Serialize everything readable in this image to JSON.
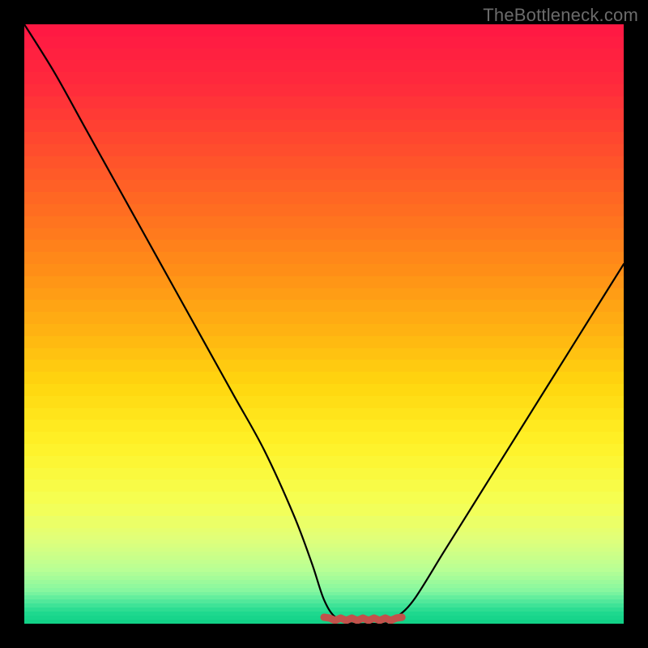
{
  "watermark": "TheBottleneck.com",
  "chart_data": {
    "type": "line",
    "title": "",
    "xlabel": "",
    "ylabel": "",
    "xlim": [
      0,
      100
    ],
    "ylim": [
      0,
      100
    ],
    "x": [
      0,
      5,
      10,
      15,
      20,
      25,
      30,
      35,
      40,
      45,
      48,
      50,
      52,
      55,
      58,
      60,
      62,
      65,
      70,
      75,
      80,
      85,
      90,
      95,
      100
    ],
    "values": [
      100,
      92,
      83,
      74,
      65,
      56,
      47,
      38,
      29,
      18,
      10,
      4,
      1,
      0,
      0,
      0,
      1,
      4,
      12,
      20,
      28,
      36,
      44,
      52,
      60
    ],
    "series": [
      {
        "name": "bottleneck-curve",
        "color": "#000000"
      }
    ],
    "marker_band": {
      "color": "#c1524b",
      "x_start": 50,
      "x_end": 63,
      "y": 0
    },
    "gradient_stops": [
      {
        "pos": 0.0,
        "color": "#ff1744"
      },
      {
        "pos": 0.1,
        "color": "#ff2a3c"
      },
      {
        "pos": 0.2,
        "color": "#ff4a2e"
      },
      {
        "pos": 0.3,
        "color": "#ff6a22"
      },
      {
        "pos": 0.4,
        "color": "#ff8b18"
      },
      {
        "pos": 0.5,
        "color": "#ffae12"
      },
      {
        "pos": 0.6,
        "color": "#ffd60f"
      },
      {
        "pos": 0.7,
        "color": "#fff227"
      },
      {
        "pos": 0.8,
        "color": "#f5ff54"
      },
      {
        "pos": 0.86,
        "color": "#e0ff7a"
      },
      {
        "pos": 0.91,
        "color": "#b8ff95"
      },
      {
        "pos": 0.945,
        "color": "#85f7a0"
      },
      {
        "pos": 0.965,
        "color": "#4de79a"
      },
      {
        "pos": 0.982,
        "color": "#1fd98f"
      },
      {
        "pos": 1.0,
        "color": "#0fcf85"
      }
    ]
  }
}
